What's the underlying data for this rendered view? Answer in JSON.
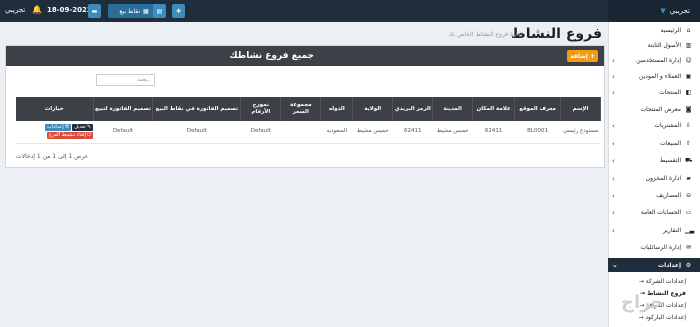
{
  "topbar": {
    "brand": "تجريبي",
    "user": "تجريبي",
    "date": "18-09-2023",
    "pos_label": "نقاط بيع"
  },
  "sidebar": {
    "items": [
      {
        "label": "الرئيسية",
        "icon": "home-icon"
      },
      {
        "label": "الأصول الثابتة",
        "icon": "building-icon"
      },
      {
        "label": "إدارة المستخدمين",
        "icon": "users-icon"
      },
      {
        "label": "العملاء و المودين",
        "icon": "address-book-icon"
      },
      {
        "label": "المنتجات",
        "icon": "cubes-icon"
      },
      {
        "label": "معرض المنتجات",
        "icon": "camera-icon"
      },
      {
        "label": "المشتريات",
        "icon": "download-icon"
      },
      {
        "label": "المبيعات",
        "icon": "upload-icon"
      },
      {
        "label": "التقسيط",
        "icon": "cart-icon"
      },
      {
        "label": "ادارة المخزون",
        "icon": "truck-icon"
      },
      {
        "label": "المصاريف",
        "icon": "minus-circle-icon"
      },
      {
        "label": "الحسابات العامة",
        "icon": "money-icon"
      },
      {
        "label": "التقارير",
        "icon": "chart-icon"
      },
      {
        "label": "إدارة الرسائليات",
        "icon": "envelope-icon"
      }
    ],
    "settings": {
      "label": "إعدادات",
      "icon": "gear-icon"
    },
    "subitems": [
      {
        "label": "→ إعدادات الشركة"
      },
      {
        "label": "→ فروع النشاط"
      },
      {
        "label": "→ إعدادات المواقع"
      },
      {
        "label": "→ إعدادات الباركود"
      }
    ],
    "watermark": "حراج"
  },
  "page": {
    "title": "فروع النشاط",
    "subtitle": "إدارة فروع النشاط الخاص بك"
  },
  "box": {
    "title": "جميع فروع نشاطك",
    "add_label": "إضافة",
    "search_placeholder": "بحث..."
  },
  "table": {
    "columns": [
      "الإسم",
      "معرف الموقع",
      "علامة المكان",
      "المدينة",
      "الرمز البريدي",
      "الولاية",
      "الدوله",
      "مجموعة السعر",
      "نموزج الأرقام",
      "تصميم الفاتورة في نقاط البيع",
      "تصميم الفاتورة لتبيع",
      "خيارات"
    ],
    "rows": [
      {
        "name": "مستودع رئيسي",
        "location_id": "BL0001",
        "landmark": "62411",
        "city": "خميس مشيط",
        "zip": "62411",
        "state": "خميس مشيط",
        "country": "السعوديه",
        "price_group": "",
        "numbering": "Default",
        "pos_invoice": "Default",
        "sale_invoice": "Default",
        "actions": {
          "edit": "تعديل",
          "settings": "إعدادات",
          "deactivate": "إلغاء تنشيط القرع"
        }
      }
    ]
  },
  "footer": {
    "info": "عرض 1 إلى 1 من 1 إدخالات"
  },
  "colors": {
    "topbar": "#1f2d3d",
    "accent": "#3c8dbc",
    "warning": "#f39c12",
    "danger": "#dd4b39"
  }
}
